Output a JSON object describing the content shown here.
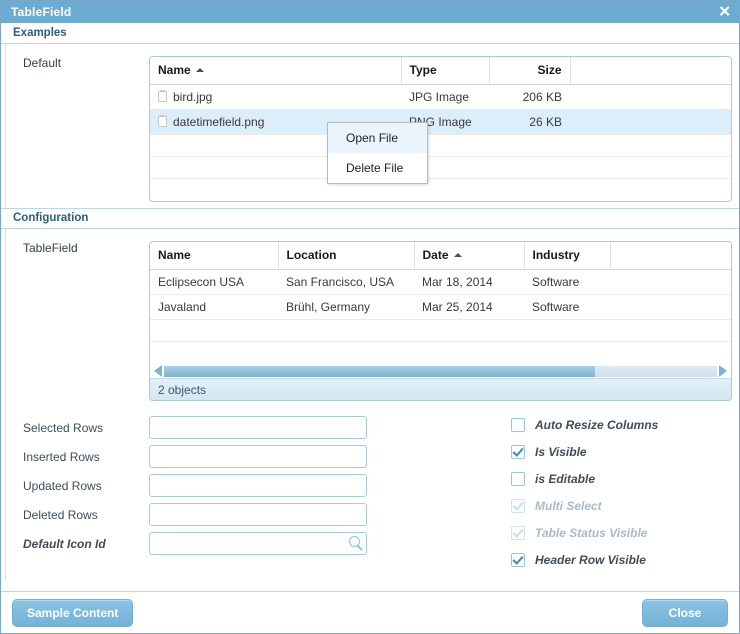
{
  "window": {
    "title": "TableField",
    "close_label": "✕"
  },
  "sections": {
    "examples": {
      "header": "Examples",
      "row_label": "Default"
    },
    "configuration": {
      "header": "Configuration",
      "row_label": "TableField"
    }
  },
  "file_table": {
    "columns": [
      "Name",
      "Type",
      "Size",
      ""
    ],
    "sorted_column": "Name",
    "sort_direction": "asc",
    "rows": [
      {
        "name": "bird.jpg",
        "type": "JPG Image",
        "size": "206 KB",
        "selected": false
      },
      {
        "name": "datetimefield.png",
        "type": "PNG Image",
        "size": "26 KB",
        "selected": true
      }
    ],
    "empty_rows": 3
  },
  "context_menu": {
    "items": [
      {
        "label": "Open File",
        "hovered": true
      },
      {
        "label": "Delete File",
        "hovered": false
      }
    ]
  },
  "event_table": {
    "columns": [
      "Name",
      "Location",
      "Date",
      "Industry",
      ""
    ],
    "sorted_column": "Date",
    "sort_direction": "asc",
    "rows": [
      {
        "name": "Eclipsecon USA",
        "location": "San Francisco, USA",
        "date": "Mar 18, 2014",
        "industry": "Software"
      },
      {
        "name": "Javaland",
        "location": "Brühl, Germany",
        "date": "Mar 25, 2014",
        "industry": "Software"
      }
    ],
    "empty_rows": 2,
    "status_text": "2 objects",
    "scroll_thumb_percent": 78
  },
  "fields": [
    {
      "label": "Selected Rows",
      "value": "",
      "placeholder": "",
      "italic": false,
      "icon": ""
    },
    {
      "label": "Inserted Rows",
      "value": "",
      "placeholder": "",
      "italic": false,
      "icon": ""
    },
    {
      "label": "Updated Rows",
      "value": "",
      "placeholder": "",
      "italic": false,
      "icon": ""
    },
    {
      "label": "Deleted Rows",
      "value": "",
      "placeholder": "",
      "italic": false,
      "icon": ""
    },
    {
      "label": "Default Icon Id",
      "value": "",
      "placeholder": "",
      "italic": true,
      "icon": "search-icon"
    }
  ],
  "checkboxes": [
    {
      "label": "Auto Resize Columns",
      "checked": false,
      "disabled": false
    },
    {
      "label": "Is Visible",
      "checked": true,
      "disabled": false
    },
    {
      "label": "is Editable",
      "checked": false,
      "disabled": false
    },
    {
      "label": "Multi Select",
      "checked": true,
      "disabled": true
    },
    {
      "label": "Table Status Visible",
      "checked": true,
      "disabled": true
    },
    {
      "label": "Header Row Visible",
      "checked": true,
      "disabled": false
    }
  ],
  "footer": {
    "sample_content_label": "Sample Content",
    "close_label": "Close"
  },
  "colors": {
    "titlebar": "#6cacd2",
    "accent": "#74b2d8",
    "section_header_text": "#2b5d7d",
    "row_selected": "#ddeefb",
    "border": "#a8cade"
  }
}
